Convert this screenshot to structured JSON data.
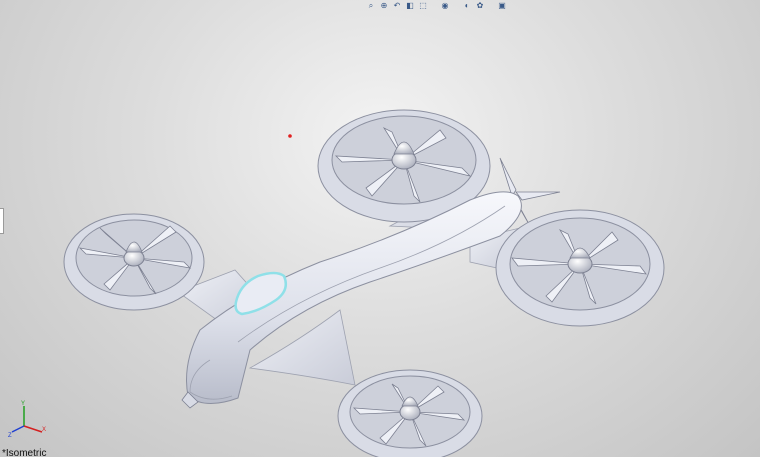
{
  "viewport": {
    "view_name": "*Isometric",
    "triad_axes": [
      "X",
      "Y",
      "Z"
    ],
    "colors": {
      "background_center": "#f3f3f3",
      "background_edge": "#c4c4c4",
      "model": "#e3e6ef",
      "selection_highlight": "#8fe0e8",
      "axis_x": "#d42020",
      "axis_y": "#20a020",
      "axis_z": "#2040d0"
    }
  },
  "heads_up_toolbar": {
    "buttons": [
      {
        "icon": "zoom-to-fit-icon",
        "glyph": "⌕"
      },
      {
        "icon": "zoom-to-area-icon",
        "glyph": "⊕"
      },
      {
        "icon": "previous-view-icon",
        "glyph": "↶"
      },
      {
        "icon": "section-view-icon",
        "glyph": "◧"
      },
      {
        "icon": "view-orientation-icon",
        "glyph": "⬚"
      },
      {
        "icon": "display-style-icon",
        "glyph": "◉"
      },
      {
        "icon": "hide-show-items-icon",
        "glyph": "◐"
      },
      {
        "icon": "edit-appearance-icon",
        "glyph": "✿"
      },
      {
        "icon": "view-settings-icon",
        "glyph": "▣"
      }
    ]
  }
}
